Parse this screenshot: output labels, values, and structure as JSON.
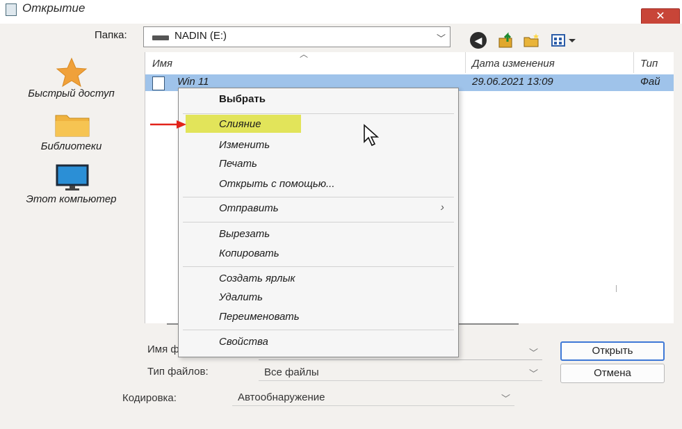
{
  "window": {
    "title": "Открытие",
    "close_label": "✕"
  },
  "toolbar": {
    "folder_label": "Папка:",
    "folder_value": "NADIN (E:)",
    "back_icon": "back-arrow-icon",
    "up_icon": "up-folder-icon",
    "newfolder_icon": "new-folder-icon",
    "view_icon": "view-menu-icon"
  },
  "sidebar": {
    "items": [
      {
        "label": "Быстрый доступ",
        "icon": "star-icon"
      },
      {
        "label": "Библиотеки",
        "icon": "folder-icon"
      },
      {
        "label": "Этот компьютер",
        "icon": "monitor-icon"
      }
    ]
  },
  "filelist": {
    "columns": [
      "Имя",
      "Дата изменения",
      "Тип"
    ],
    "rows": [
      {
        "name": "Win 11",
        "date": "29.06.2021 13:09",
        "type": "Фай"
      }
    ]
  },
  "context_menu": {
    "items": [
      {
        "label": "Выбрать"
      },
      {
        "label": "Слияние",
        "highlighted": true
      },
      {
        "label": "Изменить"
      },
      {
        "label": "Печать"
      },
      {
        "label": "Открыть с помощью..."
      },
      {
        "label": "Отправить",
        "submenu": "›"
      },
      {
        "label": "Вырезать"
      },
      {
        "label": "Копировать"
      },
      {
        "label": "Создать ярлык"
      },
      {
        "label": "Удалить"
      },
      {
        "label": "Переименовать"
      },
      {
        "label": "Свойства"
      }
    ],
    "highlight_color": "#e2e45a"
  },
  "form": {
    "filename_label": "Имя ф",
    "filename_value": "",
    "filetype_label": "Тип файлов:",
    "filetype_value": "Все файлы",
    "encoding_label": "Кодировка:",
    "encoding_value": "Автообнаружение"
  },
  "buttons": {
    "open": "Открыть",
    "cancel": "Отмена"
  },
  "colors": {
    "selection": "#9fc3ea",
    "annotation_arrow": "#e2231a",
    "primary_border": "#3e78d6"
  }
}
